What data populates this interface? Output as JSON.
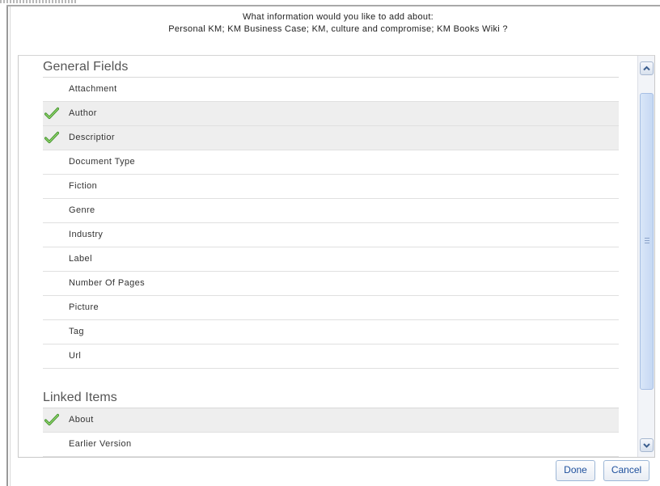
{
  "header": {
    "line1": "What information would you like to add about:",
    "line2": "Personal KM; KM Business Case; KM, culture and compromise; KM Books Wiki ?"
  },
  "sections": [
    {
      "title": "General Fields",
      "items": [
        {
          "label": "Attachment",
          "checked": false
        },
        {
          "label": "Author",
          "checked": true
        },
        {
          "label": "Descriptior",
          "checked": true
        },
        {
          "label": "Document Type",
          "checked": false
        },
        {
          "label": "Fiction",
          "checked": false
        },
        {
          "label": "Genre",
          "checked": false
        },
        {
          "label": "Industry",
          "checked": false
        },
        {
          "label": "Label",
          "checked": false
        },
        {
          "label": "Number Of Pages",
          "checked": false
        },
        {
          "label": "Picture",
          "checked": false
        },
        {
          "label": "Tag",
          "checked": false
        },
        {
          "label": "Url",
          "checked": false
        }
      ]
    },
    {
      "title": "Linked Items",
      "items": [
        {
          "label": "About",
          "checked": true
        },
        {
          "label": "Earlier Version",
          "checked": false
        }
      ]
    }
  ],
  "buttons": {
    "done": "Done",
    "cancel": "Cancel"
  },
  "icons": {
    "check": "checkmark-icon",
    "scroll_up": "chevron-up-icon",
    "scroll_down": "chevron-down-icon"
  },
  "colors": {
    "button_text": "#1d4f9c",
    "check_green": "#5aa53a",
    "selected_row": "#eeeeee"
  }
}
